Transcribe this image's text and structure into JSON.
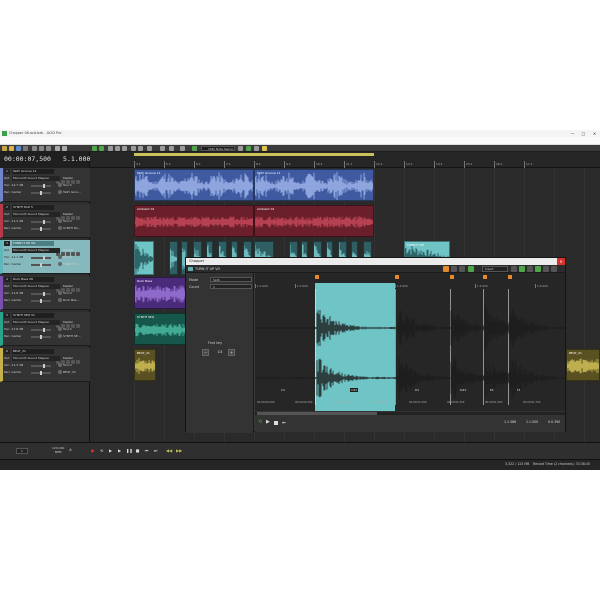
{
  "window": {
    "title": "Chopper 06.acd-bak - ACID Pro",
    "minimize": "—",
    "maximize": "□",
    "close": "✕"
  },
  "menu": [
    "File",
    "Edit",
    "View",
    "Insert",
    "Tools",
    "Options",
    "Help"
  ],
  "toolbar": {
    "snap_value": "16th Note Swing"
  },
  "time": {
    "position": "00:00:07,500",
    "tempo": "5.1.000"
  },
  "ruler": {
    "labels": [
      "4.1",
      "5.1",
      "6.1",
      "7.1",
      "8.1",
      "9.1",
      "10.1",
      "11.1",
      "12.1",
      "13.1",
      "14.1",
      "15.1",
      "16.1",
      "17.1"
    ]
  },
  "tracks": [
    {
      "num": "1",
      "name": "TaiPr Groove 11",
      "out": "Microsoft Sound Mapper",
      "bus": "Master",
      "vol": "Vol: -12.7 dB",
      "pan": "Pan: Center",
      "mode": "Touch",
      "sub": "TaiPr Groo..."
    },
    {
      "num": "2",
      "name": "SYNTH PAD 5",
      "out": "Microsoft Sound Mapper",
      "bus": "Master",
      "vol": "Vol: -11.2 dB",
      "pan": "Pan: Center",
      "mode": "Touch",
      "sub": "SYNTH PA..."
    },
    {
      "num": "3",
      "name": "TURN IT UP VO",
      "out": "Microsoft Sound Mapper",
      "bus": "Master",
      "vol": "Vol: -11.1 dB",
      "pan": "Pan: Center",
      "mode": "Touch",
      "sub": "TURN IT U..."
    },
    {
      "num": "4",
      "name": "Rock Bass 08",
      "out": "Microsoft Sound Mapper",
      "bus": "Master",
      "vol": "Vol: -11.8 dB",
      "pan": "Pan: Center",
      "mode": "Touch",
      "sub": "Rock Bas..."
    },
    {
      "num": "5",
      "name": "SYNTH SEQ 51",
      "out": "Microsoft Sound Mapper",
      "bus": "Master",
      "vol": "Vol: -17.8 dB",
      "pan": "Pan: Center",
      "mode": "Touch",
      "sub": "SYNTH SE..."
    },
    {
      "num": "6",
      "name": "BEAT_21",
      "out": "Microsoft Sound Mapper",
      "bus": "Master",
      "vol": "Vol: -11.3 dB",
      "pan": "Pan: Center",
      "mode": "Touch",
      "sub": "BEAT_21"
    }
  ],
  "clips": {
    "track1": "TaiPr Groove 11",
    "track2": "Ambient 01",
    "track3": "TURN IT UP",
    "track4": "Rock Bass",
    "track5": "SYNTH SEQ",
    "track6": "BEAT_21"
  },
  "chopper": {
    "title": "Chopper",
    "close": "✕",
    "track": "TURN IT UP VO",
    "insert": "Insert",
    "mode_label": "Mode",
    "mode_value": "Split",
    "count_label": "Count",
    "count_value": "1",
    "first_key_label": "First key",
    "key_value": "C4",
    "minus": "−",
    "plus": "+",
    "ruler_labels": [
      "1.1.000",
      "1.2.000",
      "1.1.586",
      "1.1.000",
      "1.4.000",
      "1.5.000",
      "1.6.000"
    ],
    "slice_labels": [
      "C4",
      "C#4",
      "D4",
      "D#4",
      "E4",
      "F4"
    ],
    "time_ticks": [
      "00:00:00,000",
      "00:00:00,250",
      "00:00:00,500",
      "00:00:00,750",
      "00:00:01,000",
      "00:00:01,250",
      "00:00:01,500",
      "00:00:01,750"
    ],
    "footer_values": [
      "1.1.586",
      "1.1.000",
      "0.0.390"
    ]
  },
  "transport": {
    "zoom": "1",
    "tempo_value": "120.000",
    "tempo_label": "BPM",
    "key": "A"
  },
  "status": {
    "disk": "3,322 / 123 MB",
    "record_time": "Record Time (2 channels): 33:38:45"
  }
}
